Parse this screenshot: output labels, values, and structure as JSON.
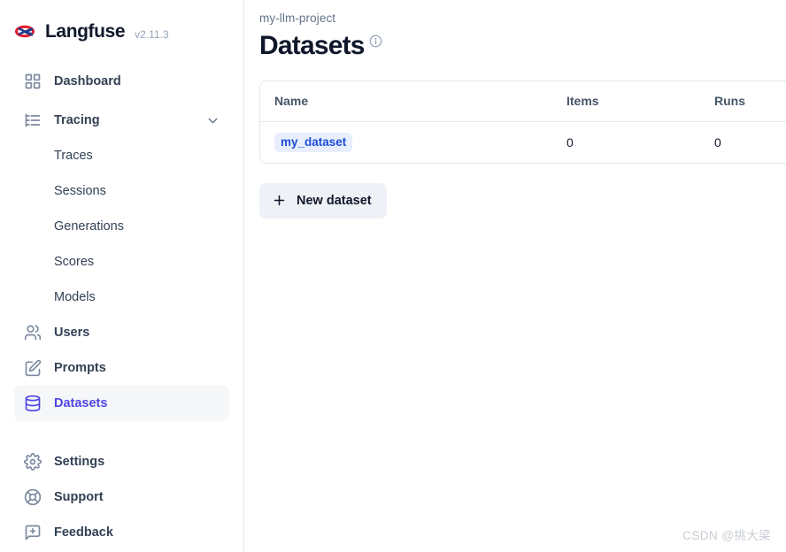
{
  "brand": {
    "name": "Langfuse",
    "version": "v2.11.3",
    "logo_icon": "langfuse-logo-icon"
  },
  "sidebar": {
    "items": [
      {
        "label": "Dashboard",
        "icon": "layout-dashboard-icon",
        "active": false,
        "type": "item"
      },
      {
        "label": "Tracing",
        "icon": "list-tree-icon",
        "active": false,
        "type": "group",
        "expanded": true,
        "chevron": "chevron-down-icon"
      },
      {
        "label": "Traces",
        "type": "sub"
      },
      {
        "label": "Sessions",
        "type": "sub"
      },
      {
        "label": "Generations",
        "type": "sub"
      },
      {
        "label": "Scores",
        "type": "sub"
      },
      {
        "label": "Models",
        "type": "sub"
      },
      {
        "label": "Users",
        "icon": "users-icon",
        "active": false,
        "type": "item"
      },
      {
        "label": "Prompts",
        "icon": "square-pen-icon",
        "active": false,
        "type": "item"
      },
      {
        "label": "Datasets",
        "icon": "database-icon",
        "active": true,
        "type": "item"
      }
    ],
    "bottom_items": [
      {
        "label": "Settings",
        "icon": "gear-icon"
      },
      {
        "label": "Support",
        "icon": "life-buoy-icon"
      },
      {
        "label": "Feedback",
        "icon": "message-square-plus-icon"
      }
    ],
    "active_color": "#4f46e5"
  },
  "main": {
    "breadcrumb": "my-llm-project",
    "page_title": "Datasets",
    "info_icon": "info-circle-icon",
    "table": {
      "columns": [
        "Name",
        "Items",
        "Runs"
      ],
      "rows": [
        {
          "name": "my_dataset",
          "items": "0",
          "runs": "0"
        }
      ]
    },
    "new_dataset_button": {
      "label": "New dataset",
      "icon": "plus-icon"
    }
  },
  "watermark": "CSDN @挑大梁"
}
